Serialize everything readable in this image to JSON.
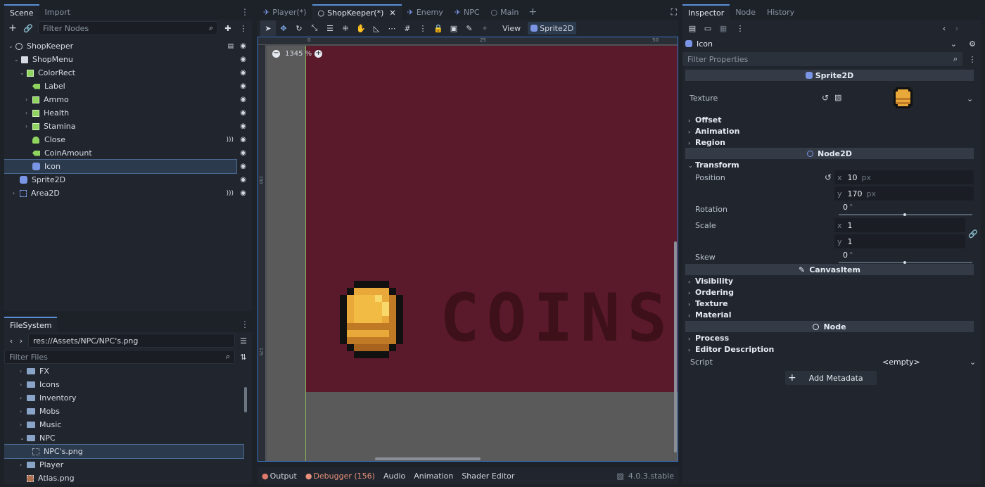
{
  "scene_panel": {
    "tabs": [
      "Scene",
      "Import"
    ],
    "filter_placeholder": "Filter Nodes",
    "nodes": [
      {
        "label": "ShopKeeper"
      },
      {
        "label": "ShopMenu"
      },
      {
        "label": "ColorRect"
      },
      {
        "label": "Label"
      },
      {
        "label": "Ammo"
      },
      {
        "label": "Health"
      },
      {
        "label": "Stamina"
      },
      {
        "label": "Close"
      },
      {
        "label": "CoinAmount"
      },
      {
        "label": "Icon"
      },
      {
        "label": "Sprite2D"
      },
      {
        "label": "Area2D"
      }
    ]
  },
  "filesystem": {
    "tab": "FileSystem",
    "path": "res://Assets/NPC/NPC's.png",
    "filter_placeholder": "Filter Files",
    "items": [
      {
        "label": "FX"
      },
      {
        "label": "Icons"
      },
      {
        "label": "Inventory"
      },
      {
        "label": "Mobs"
      },
      {
        "label": "Music"
      },
      {
        "label": "NPC"
      },
      {
        "label": "NPC's.png"
      },
      {
        "label": "Player"
      },
      {
        "label": "Atlas.png"
      }
    ]
  },
  "editor_tabs": [
    "Player(*)",
    "ShopKeeper(*)",
    "Enemy",
    "NPC",
    "Main"
  ],
  "toolbar": {
    "view_label": "View",
    "sprite_label": "Sprite2D"
  },
  "viewport": {
    "zoom": "1345 %",
    "ruler_top": [
      "0",
      "25",
      "50"
    ],
    "ruler_left": [
      "150",
      "175"
    ],
    "canvas_text": "COINS :",
    "bg_color": "#5a1a2b"
  },
  "bottom_bar": {
    "items": [
      "Output",
      "Debugger (156)",
      "Audio",
      "Animation",
      "Shader Editor"
    ],
    "version": "4.0.3.stable"
  },
  "inspector": {
    "tabs": [
      "Inspector",
      "Node",
      "History"
    ],
    "object_name": "Icon",
    "filter_placeholder": "Filter Properties",
    "sections": {
      "sprite2d": "Sprite2D",
      "node2d": "Node2D",
      "canvasitem": "CanvasItem",
      "node": "Node"
    },
    "texture_label": "Texture",
    "sprite_groups": [
      "Offset",
      "Animation",
      "Region"
    ],
    "transform_label": "Transform",
    "position_label": "Position",
    "position_x": "10",
    "position_y": "170",
    "unit_px": "px",
    "axis_x": "x",
    "axis_y": "y",
    "rotation_label": "Rotation",
    "rotation_value": "0",
    "scale_label": "Scale",
    "scale_x": "1",
    "scale_y": "1",
    "skew_label": "Skew",
    "skew_value": "0",
    "degree": "°",
    "canvas_groups": [
      "Visibility",
      "Ordering",
      "Texture",
      "Material"
    ],
    "node_groups": [
      "Process",
      "Editor Description"
    ],
    "script_label": "Script",
    "script_value": "<empty>",
    "add_metadata": "Add Metadata"
  }
}
